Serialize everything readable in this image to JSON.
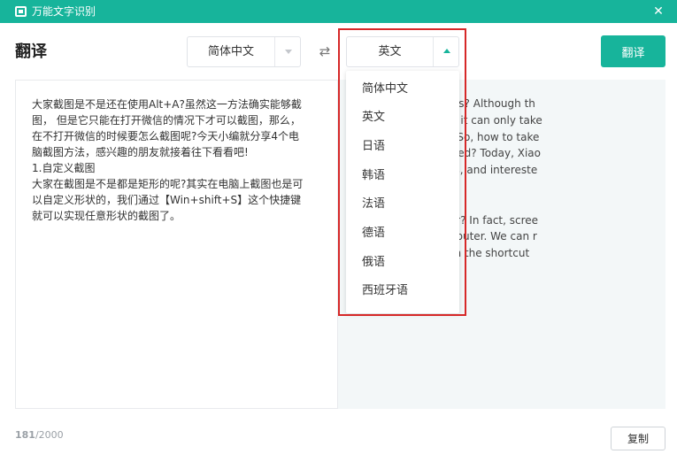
{
  "window": {
    "title": "万能文字识别",
    "close_glyph": "✕"
  },
  "page_title": "翻译",
  "source_lang": "简体中文",
  "target_lang": "英文",
  "swap_glyph": "⇄",
  "translate_button": "翻译",
  "source_text": "大家截图是不是还在使用Alt+A?虽然这一方法确实能够截\n图， 但是它只能在打开微信的情况下才可以截图，那么，\n在不打开微信的时候要怎么截图呢?今天小编就分享4个电\n脑截图方法，感兴趣的朋友就接着往下看看吧!\n1.自定义截图\n大家在截图是不是都是矩形的呢?其实在电脑上截图也是可\n以自定义形状的，我们通过【Win+shift+S】这个快捷键\n就可以实现任意形状的截图了。",
  "translated_text": "lt + A in screenshots? Although th\ny take screenshots, it can only take\nWeChat is opened. So, how to take\nWeChat is not opened? Today, Xiao\nmputer screenshots, and intereste\nue to look down!\nnshots\nenshots rectangular? In fact, scree\nomized on the computer. We can r\nf any shape through the shortcut\n\"S\".",
  "char_count": {
    "current": "181",
    "max": "/2000"
  },
  "copy_button": "复制",
  "dropdown_options": [
    "简体中文",
    "英文",
    "日语",
    "韩语",
    "法语",
    "德语",
    "俄语",
    "西班牙语"
  ],
  "colors": {
    "accent": "#17b49b",
    "highlight": "#d62828"
  }
}
